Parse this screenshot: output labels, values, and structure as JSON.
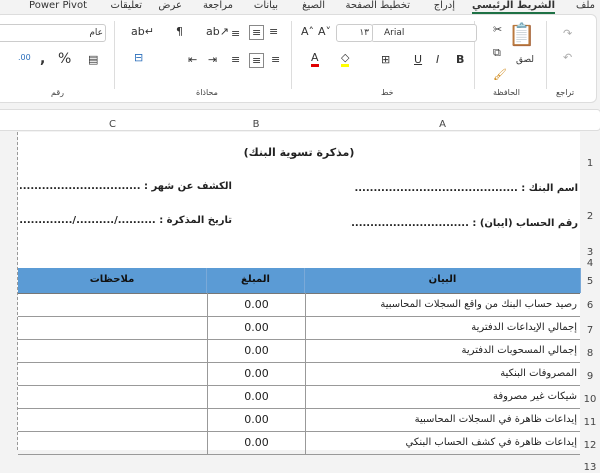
{
  "tabs": [
    "ملف",
    "الشريط الرئيسي",
    "إدراج",
    "تخطيط الصفحة",
    "الصيغ",
    "بيانات",
    "مراجعة",
    "عرض",
    "تعليقات",
    "Power Pivot"
  ],
  "ribbon": {
    "groups": {
      "undo": "تراجع",
      "clipboard": "الحافظة",
      "font": "خط",
      "alignment": "محاذاة",
      "number": "رقم"
    },
    "paste_label": "لصق",
    "font_name": "Arial",
    "font_size": "١٣",
    "number_format": "عام",
    "font_color": "#e00000",
    "fill_color": "#ffff00"
  },
  "columns": [
    "A",
    "B",
    "C"
  ],
  "rows": [
    "1",
    "2",
    "3",
    "4",
    "5",
    "6",
    "7",
    "8",
    "9",
    "10",
    "11",
    "12",
    "13"
  ],
  "sheet": {
    "title": "(مذكرة تسوية البنك)",
    "bank_name": "اسم البنك : ......................................................",
    "statement_month": "الكشف عن شهر : .....................................",
    "account_number": "رقم الحساب (أيبان) : ..........................................",
    "memo_date": "تاريخ المذكرة : ........../........../..............",
    "headers": [
      "البيان",
      "المبلغ",
      "ملاحظات"
    ],
    "items": [
      {
        "desc": "رصيد حساب البنك من واقع السجلات المحاسبية",
        "amount": "0.00"
      },
      {
        "desc": "إجمالي الإيداعات الدفترية",
        "amount": "0.00"
      },
      {
        "desc": "إجمالي المسحوبات الدفترية",
        "amount": "0.00"
      },
      {
        "desc": "المصروفات البنكية",
        "amount": "0.00"
      },
      {
        "desc": "شيكات غير مصروفة",
        "amount": "0.00"
      },
      {
        "desc": "إيداعات ظاهرة في السجلات المحاسبية",
        "amount": "0.00"
      },
      {
        "desc": "إيداعات ظاهرة في كشف الحساب البنكي",
        "amount": "0.00"
      }
    ]
  }
}
